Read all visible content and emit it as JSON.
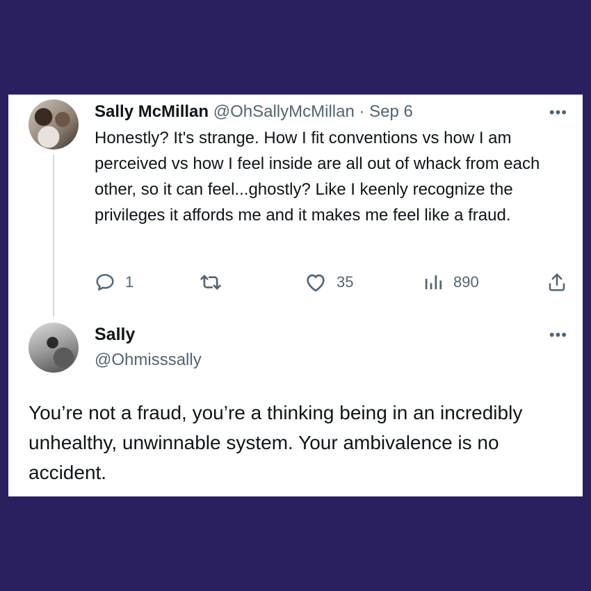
{
  "colors": {
    "page_background": "#2a2060",
    "card_background": "#ffffff",
    "primary_text": "#0f1419",
    "secondary_text": "#536471",
    "thread_line": "#cfd9de"
  },
  "tweet": {
    "author_name": "Sally McMillan",
    "handle": "@OhSallyMcMillan",
    "separator": "·",
    "date": "Sep 6",
    "more_label": "•••",
    "text": "Honestly? It's strange. How I fit conventions vs how I am perceived vs how I feel inside are all out of whack from each other, so it can feel...ghostly? Like I keenly recognize the privileges it affords me and it makes me feel like a fraud.",
    "actions": {
      "reply_count": "1",
      "retweet_count": "",
      "like_count": "35",
      "view_count": "890"
    },
    "icons": [
      "reply-icon",
      "retweet-icon",
      "like-icon",
      "views-icon",
      "share-icon"
    ]
  },
  "reply": {
    "author_name": "Sally",
    "handle": "@Ohmisssally",
    "more_label": "•••",
    "text": "You’re not a fraud, you’re a thinking being in an incredibly unhealthy, unwinnable system. Your ambivalence is no accident."
  }
}
